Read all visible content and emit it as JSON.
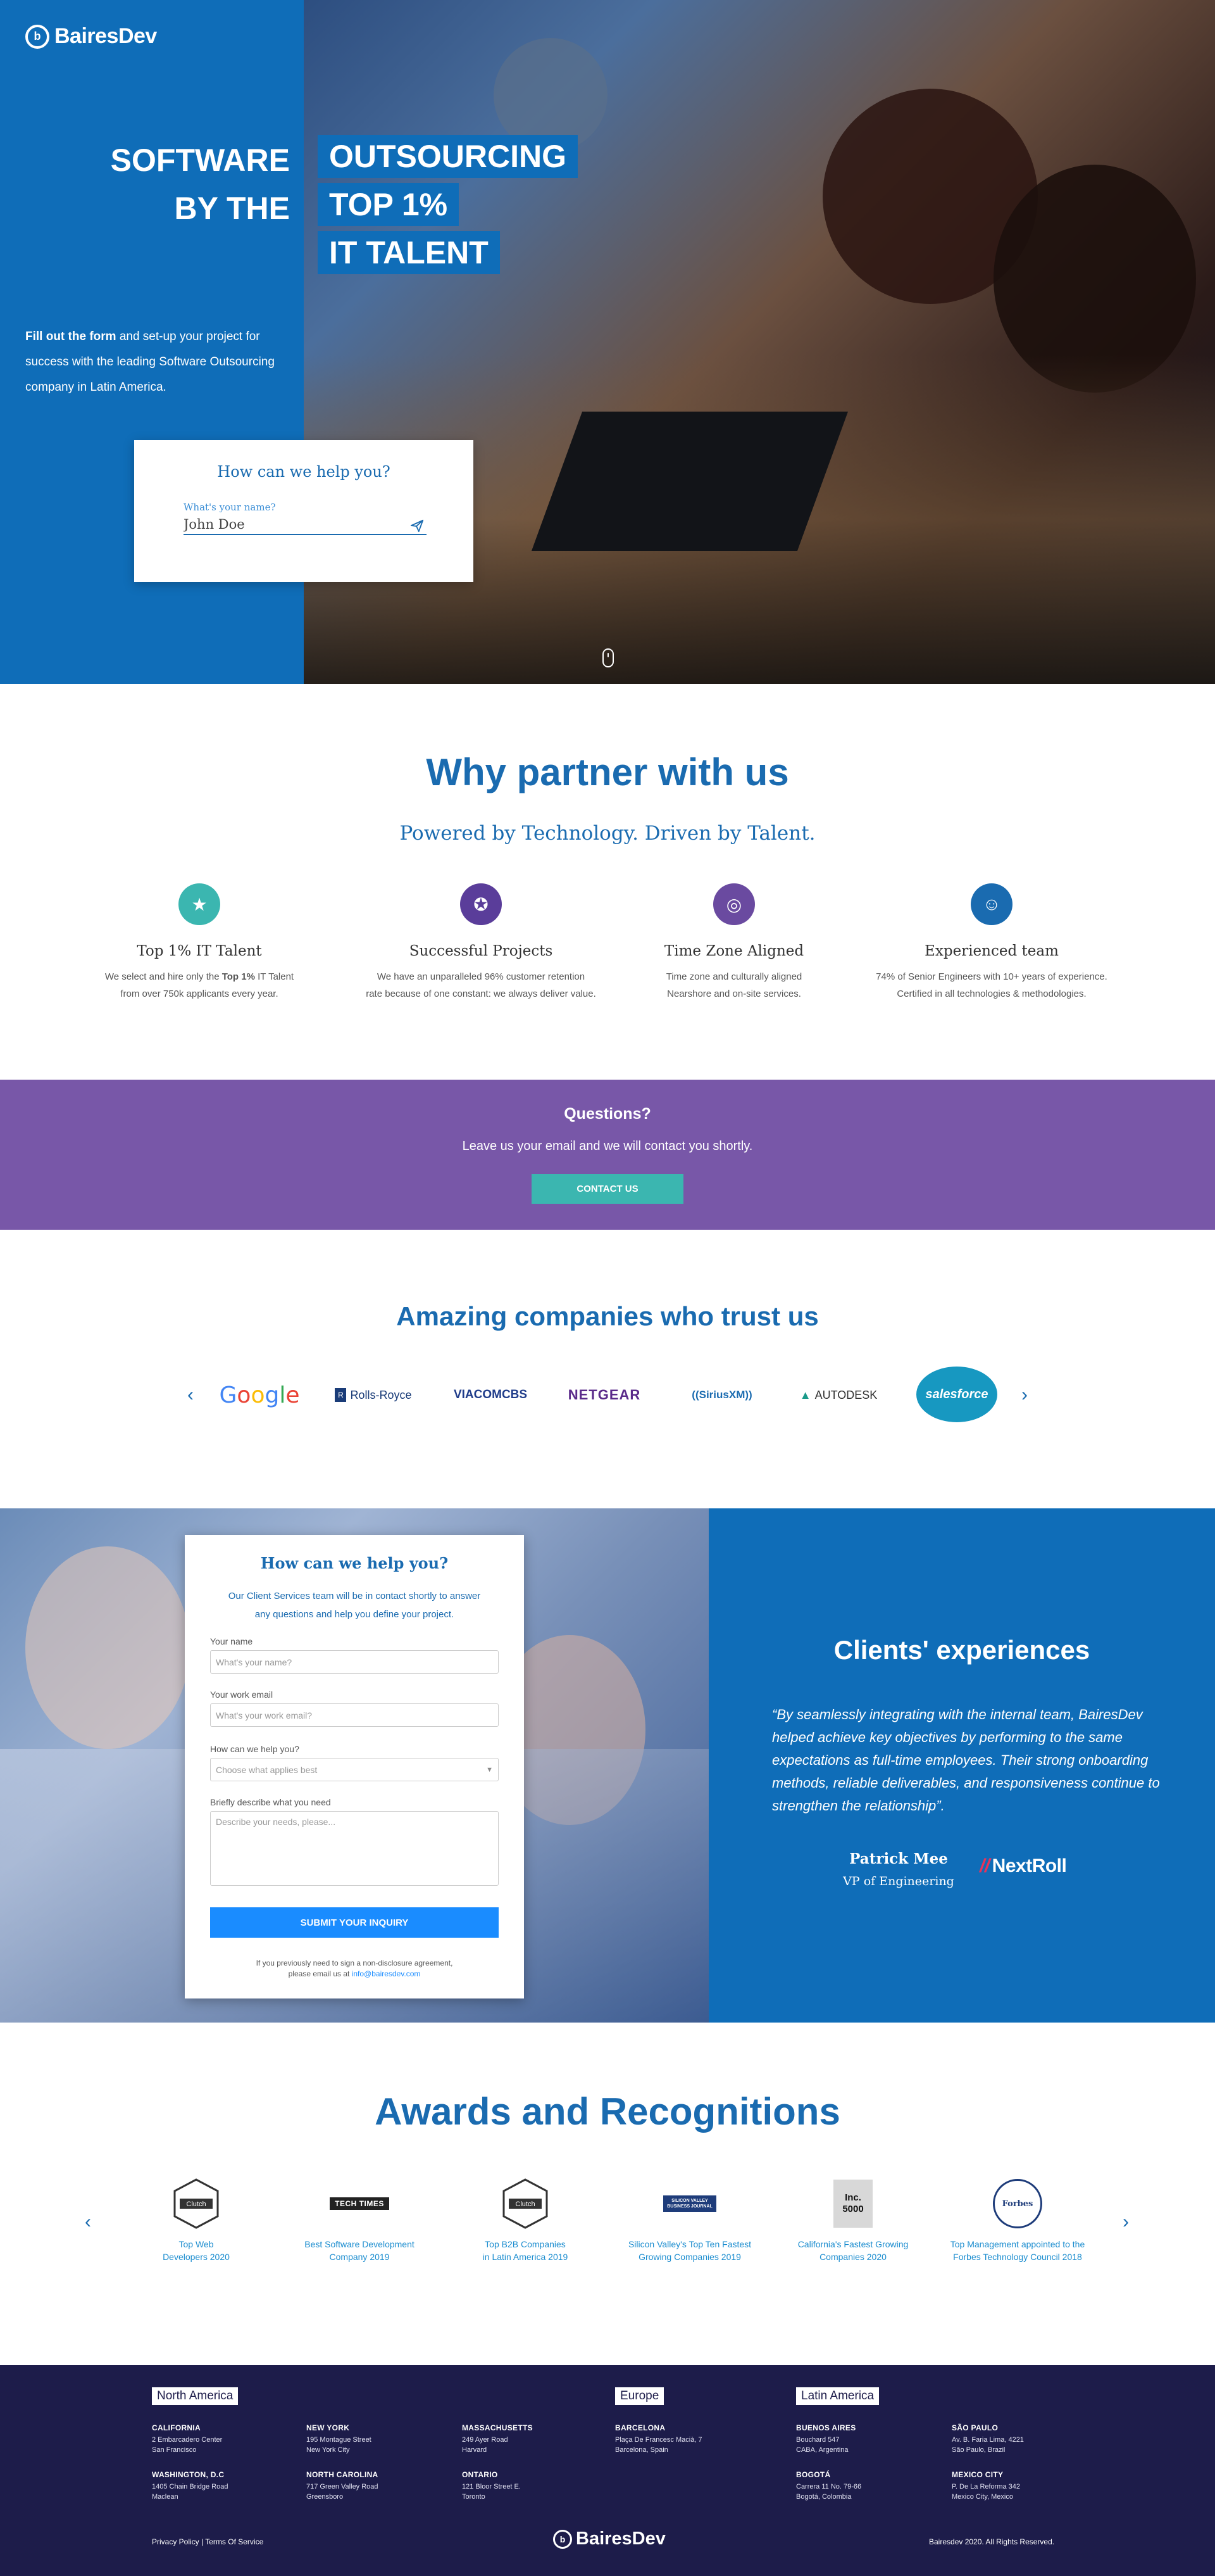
{
  "brand": {
    "name": "BairesDev",
    "mark": "b"
  },
  "hero": {
    "headline_left": [
      "SOFTWARE",
      "BY THE"
    ],
    "headline_right": [
      "OUTSOURCING",
      "TOP 1%",
      "IT TALENT"
    ],
    "desc_bold": "Fill out the form",
    "desc_rest": " and set-up your project for success with the leading Software Outsourcing company in Latin America.",
    "form": {
      "title": "How can we help you?",
      "label": "What's your name?",
      "value": "John Doe"
    }
  },
  "why": {
    "title": "Why partner with us",
    "subtitle": "Powered by Technology. Driven by Talent.",
    "features": [
      {
        "icon": "top-talent-icon",
        "color": "#3bb6b0",
        "glyph": "★",
        "title": "Top 1% IT Talent",
        "line1_pre": "We select and hire only the ",
        "line1_bold": "Top 1%",
        "line1_post": " IT Talent",
        "line2": "from over 750k applicants every year."
      },
      {
        "icon": "medal-icon",
        "color": "#5a3d9a",
        "glyph": "✪",
        "title": "Successful Projects",
        "line1_pre": "We have an unparalleled 96% customer retention",
        "line1_bold": "",
        "line1_post": "",
        "line2": "rate because of one constant: we always deliver value."
      },
      {
        "icon": "globe-icon",
        "color": "#6a4aa0",
        "glyph": "◎",
        "title": "Time Zone Aligned",
        "line1_pre": "Time zone and culturally aligned",
        "line1_bold": "",
        "line1_post": "",
        "line2": "Nearshore and on-site services."
      },
      {
        "icon": "team-icon",
        "color": "#1a6bb0",
        "glyph": "☺",
        "title": "Experienced team",
        "line1_pre": "74% of Senior Engineers with 10+ years of experience.",
        "line1_bold": "",
        "line1_post": "",
        "line2": "Certified in all technologies & methodologies."
      }
    ]
  },
  "cta": {
    "title": "Questions?",
    "subtitle": "Leave us your email and we will contact you shortly.",
    "button": "CONTACT US"
  },
  "trust": {
    "title": "Amazing companies who trust us",
    "prev": "‹",
    "next": "›",
    "logos": [
      {
        "name": "Google",
        "color": "#4285f4"
      },
      {
        "name": "Rolls-Royce",
        "color": "#1a3c78"
      },
      {
        "name": "VIACOMCBS",
        "color": "#1f3c8a"
      },
      {
        "name": "NETGEAR",
        "color": "#5a2a8a"
      },
      {
        "name": "SiriusXM",
        "color": "#1a6bb0"
      },
      {
        "name": "AUTODESK",
        "color": "#333333"
      },
      {
        "name": "salesforce",
        "color": "#ffffff"
      }
    ]
  },
  "contact": {
    "title": "How can we help you?",
    "intro": "Our Client Services team will be in contact shortly to answer any questions and help you define your project.",
    "fields": {
      "name_label": "Your name",
      "name_ph": "What's your name?",
      "email_label": "Your work email",
      "email_ph": "What's your work email?",
      "help_label": "How can we help you?",
      "help_ph": "Choose what applies best",
      "desc_label": "Briefly describe what you need",
      "desc_ph": "Describe your needs, please..."
    },
    "submit": "SUBMIT YOUR INQUIRY",
    "note_line1": "If you previously need to sign a non-disclosure agreement,",
    "note_pre": "please email us at ",
    "note_email": "info@bairesdev.com"
  },
  "clients": {
    "title": "Clients' experiences",
    "quote": "“By seamlessly integrating with the internal team, BairesDev helped achieve key objectives by performing to the same expectations as full-time employees. Their strong onboarding methods, reliable deliverables, and responsiveness continue to strengthen the relationship”.",
    "name": "Patrick Mee",
    "role": "VP of Engineering",
    "company": "NextRoll"
  },
  "awards": {
    "title": "Awards and Recognitions",
    "prev": "‹",
    "next": "›",
    "items": [
      {
        "badge": "Clutch",
        "line1": "Top Web",
        "line2": "Developers 2020"
      },
      {
        "badge": "TECH TIMES",
        "line1": "Best Software Development",
        "line2": "Company 2019"
      },
      {
        "badge": "Clutch",
        "line1": "Top B2B Companies",
        "line2": "in Latin America 2019"
      },
      {
        "badge": "SILICON VALLEY BUSINESS JOURNAL",
        "line1": "Silicon Valley's Top Ten Fastest",
        "line2": "Growing Companies 2019"
      },
      {
        "badge": "Inc. 5000",
        "line1": "California's Fastest Growing",
        "line2": "Companies 2020"
      },
      {
        "badge": "Forbes",
        "line1": "Top Management appointed to the",
        "line2": "Forbes Technology Council 2018"
      }
    ]
  },
  "footer": {
    "regions": [
      "North America",
      "Europe",
      "Latin America"
    ],
    "offices": [
      {
        "city": "CALIFORNIA",
        "l1": "2 Embarcadero Center",
        "l2": "San Francisco"
      },
      {
        "city": "NEW YORK",
        "l1": "195 Montague Street",
        "l2": "New York City"
      },
      {
        "city": "MASSACHUSETTS",
        "l1": "249 Ayer Road",
        "l2": "Harvard"
      },
      {
        "city": "BARCELONA",
        "l1": "Plaça De Francesc Macià, 7",
        "l2": "Barcelona, Spain"
      },
      {
        "city": "BUENOS AIRES",
        "l1": "Bouchard 547",
        "l2": "CABA, Argentina"
      },
      {
        "city": "SÃO PAULO",
        "l1": "Av. B. Faria Lima, 4221",
        "l2": "São Paulo, Brazil"
      },
      {
        "city": "WASHINGTON, D.C",
        "l1": "1405 Chain Bridge Road",
        "l2": "Maclean"
      },
      {
        "city": "NORTH CAROLINA",
        "l1": "717 Green Valley Road",
        "l2": "Greensboro"
      },
      {
        "city": "ONTARIO",
        "l1": "121 Bloor Street E.",
        "l2": "Toronto"
      },
      {
        "city": "BOGOTÁ",
        "l1": "Carrera 11 No. 79-66",
        "l2": "Bogotá, Colombia"
      },
      {
        "city": "MEXICO CITY",
        "l1": "P. De La Reforma 342",
        "l2": "Mexico City, Mexico"
      }
    ],
    "policy": "Privacy Policy | Terms Of Service",
    "copyright": "Bairesdev 2020.  All Rights Reserved."
  }
}
